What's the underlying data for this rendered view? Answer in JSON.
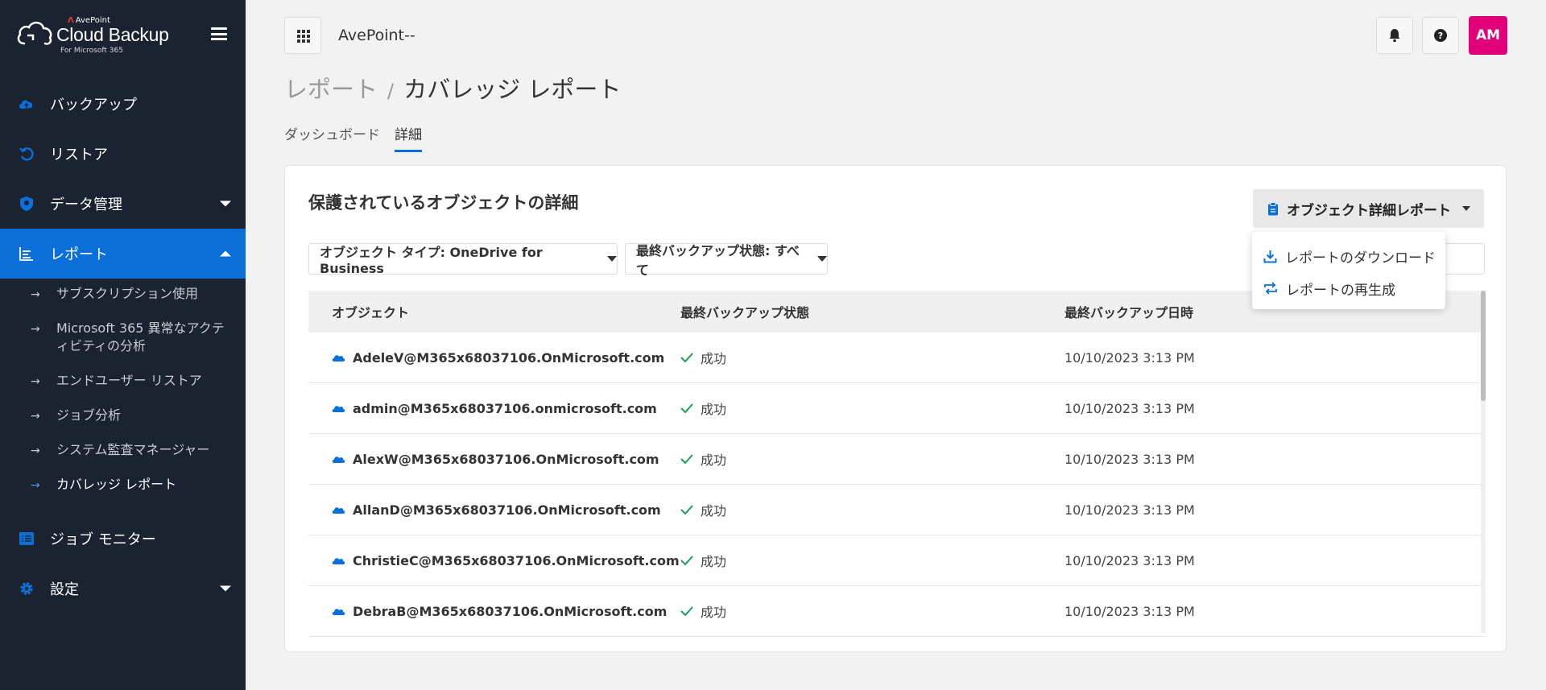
{
  "brand": {
    "company": "AvePoint",
    "product": "Cloud Backup",
    "subtitle": "For Microsoft 365"
  },
  "icons": {
    "menu": "hamburger-icon",
    "apps": "apps-grid-icon",
    "notifications": "bell-icon",
    "help": "help-icon"
  },
  "colors": {
    "sidebar_bg": "#1b2230",
    "accent": "#0a6fd8",
    "avatar": "#e2007a",
    "success": "#1a9e55"
  },
  "sidebar": {
    "items": [
      {
        "label": "バックアップ",
        "icon": "cloud-upload-icon"
      },
      {
        "label": "リストア",
        "icon": "restore-icon"
      },
      {
        "label": "データ管理",
        "icon": "shield-icon"
      },
      {
        "label": "レポート",
        "icon": "report-chart-icon"
      },
      {
        "label": "ジョブ モニター",
        "icon": "list-icon"
      },
      {
        "label": "設定",
        "icon": "gear-icon"
      }
    ],
    "report_sub": [
      "サブスクリプション使用",
      "Microsoft 365 異常なアクティビティの分析",
      "エンドユーザー リストア",
      "ジョブ分析",
      "システム監査マネージャー",
      "カバレッジ レポート"
    ]
  },
  "topbar": {
    "tenant": "AvePoint--",
    "avatar": "AM"
  },
  "breadcrumb": {
    "parent": "レポート",
    "sep": "/",
    "current": "カバレッジ レポート"
  },
  "tabs": [
    "ダッシュボード",
    "詳細"
  ],
  "card": {
    "title": "保護されているオブジェクトの詳細",
    "report_button": "オブジェクト詳細レポート",
    "filters": {
      "object_type": "オブジェクト タイプ: OneDrive for Business",
      "status": "最終バックアップ状態: すべて"
    },
    "columns": [
      "オブジェクト",
      "最終バックアップ状態",
      "最終バックアップ日時"
    ],
    "rows": [
      {
        "object": "AdeleV@M365x68037106.OnMicrosoft.com",
        "status": "成功",
        "time": "10/10/2023 3:13 PM"
      },
      {
        "object": "admin@M365x68037106.onmicrosoft.com",
        "status": "成功",
        "time": "10/10/2023 3:13 PM"
      },
      {
        "object": "AlexW@M365x68037106.OnMicrosoft.com",
        "status": "成功",
        "time": "10/10/2023 3:13 PM"
      },
      {
        "object": "AllanD@M365x68037106.OnMicrosoft.com",
        "status": "成功",
        "time": "10/10/2023 3:13 PM"
      },
      {
        "object": "ChristieC@M365x68037106.OnMicrosoft.com",
        "status": "成功",
        "time": "10/10/2023 3:13 PM"
      },
      {
        "object": "DebraB@M365x68037106.OnMicrosoft.com",
        "status": "成功",
        "time": "10/10/2023 3:13 PM"
      }
    ]
  },
  "dropdown": {
    "download": "レポートのダウンロード",
    "regenerate": "レポートの再生成"
  }
}
